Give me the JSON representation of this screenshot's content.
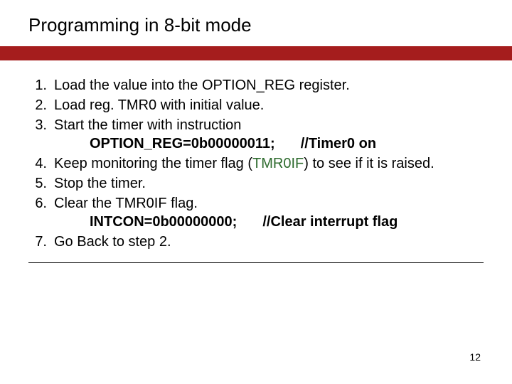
{
  "title": "Programming in 8-bit mode",
  "items": {
    "1": {
      "num": "1.",
      "text": "Load the value into the OPTION_REG register."
    },
    "2": {
      "num": "2.",
      "text": "Load reg. TMR0 with initial value."
    },
    "3": {
      "num": "3.",
      "text": "Start the timer with instruction",
      "code": "OPTION_REG=0b00000011;",
      "comment": "//Timer0 on"
    },
    "4": {
      "num": "4.",
      "text_pre": "Keep monitoring the timer flag (",
      "flag": "TMR0IF",
      "text_post": ") to see if it is raised."
    },
    "5": {
      "num": "5.",
      "text": "Stop the timer."
    },
    "6": {
      "num": "6.",
      "text": "Clear the TMR0IF flag.",
      "code": "INTCON=0b00000000;",
      "comment": "//Clear interrupt flag"
    },
    "7": {
      "num": "7.",
      "text": "Go Back to step 2."
    }
  },
  "page_number": "12"
}
